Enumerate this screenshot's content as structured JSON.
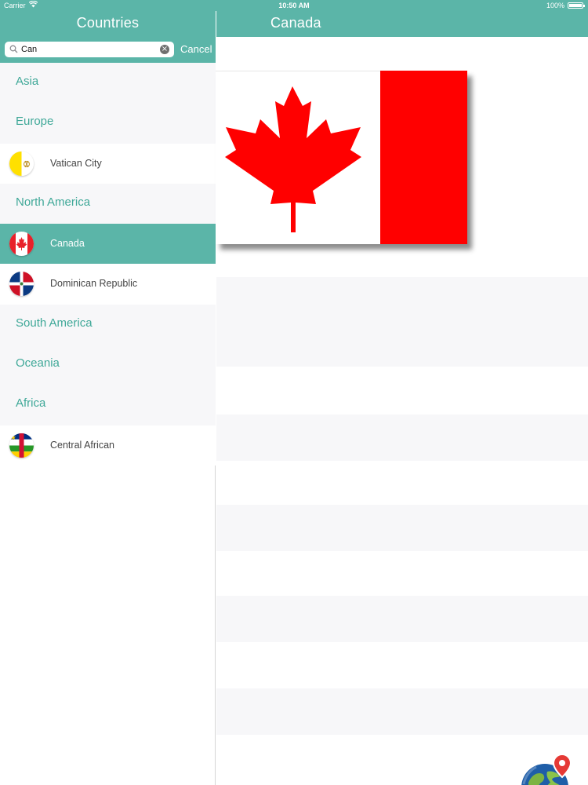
{
  "status_bar": {
    "carrier": "Carrier",
    "time": "10:50 AM",
    "battery": "100%"
  },
  "sidebar": {
    "title": "Countries",
    "search": {
      "value": "Can",
      "placeholder": "Search",
      "cancel_label": "Cancel"
    },
    "rows": [
      {
        "type": "section",
        "label": "Asia"
      },
      {
        "type": "section",
        "label": "Europe"
      },
      {
        "type": "country",
        "label": "Vatican City",
        "flag_icon": "vatican-flag-icon"
      },
      {
        "type": "section",
        "label": "North America"
      },
      {
        "type": "country",
        "label": "Canada",
        "flag_icon": "canada-flag-icon",
        "selected": true
      },
      {
        "type": "country",
        "label": "Dominican Republic",
        "flag_icon": "dominican-republic-flag-icon"
      },
      {
        "type": "section",
        "label": "South America"
      },
      {
        "type": "section",
        "label": "Oceania"
      },
      {
        "type": "section",
        "label": "Africa"
      },
      {
        "type": "country",
        "label": "Central African",
        "flag_icon": "central-african-flag-icon"
      }
    ]
  },
  "detail": {
    "title": "Canada",
    "flag_icon": "canada-flag-icon",
    "map_button_icon": "globe-location-icon"
  },
  "colors": {
    "accent": "#5bb5a8",
    "section_text": "#3fa898",
    "stripe": "#f7f7f9",
    "canada_red": "#ff0000"
  }
}
